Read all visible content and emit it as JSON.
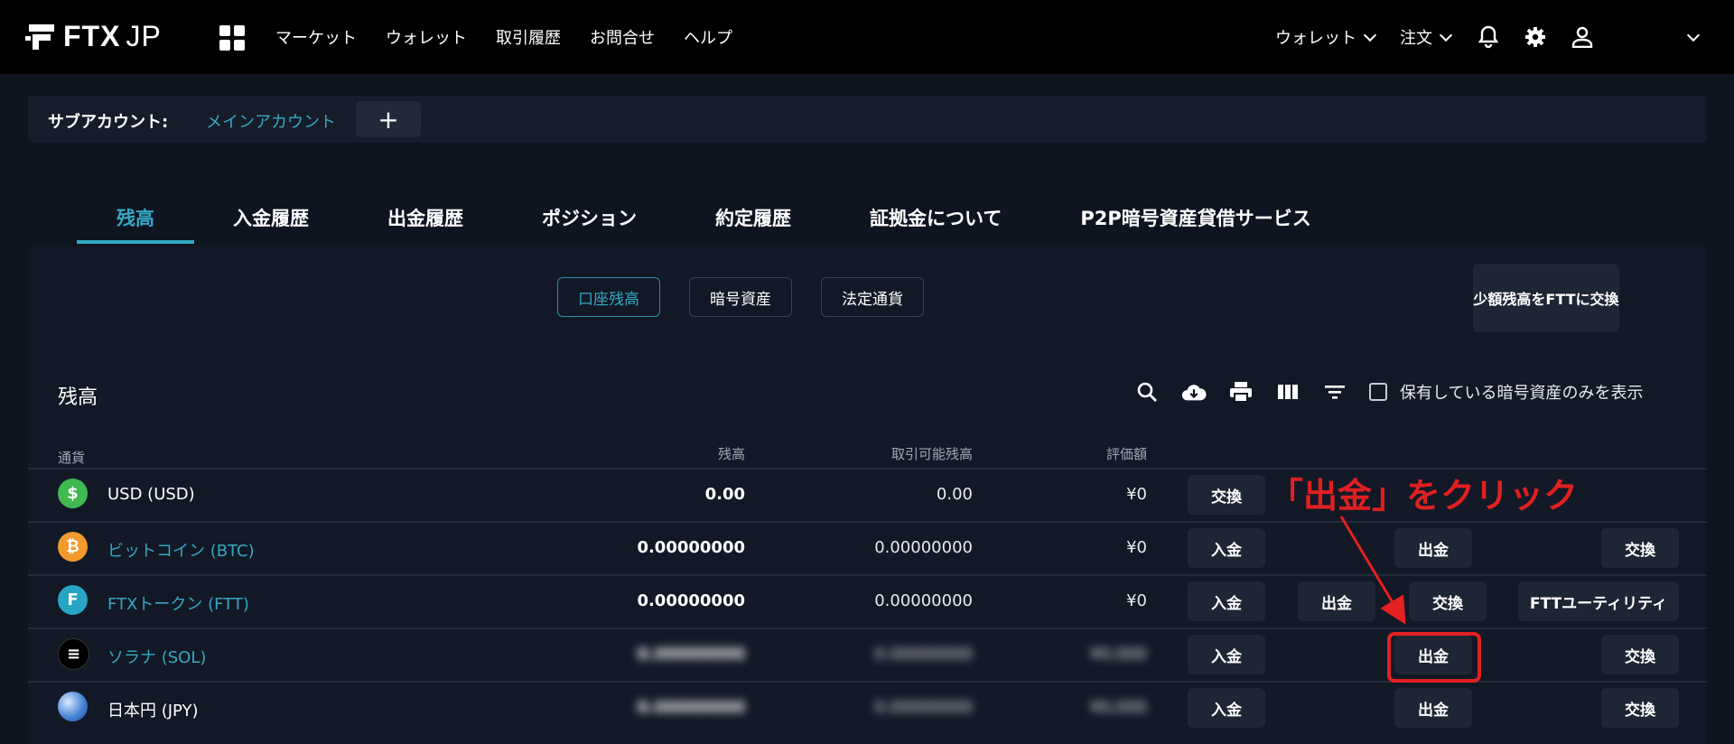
{
  "header": {
    "logo_bold": "FTX",
    "logo_light": "JP",
    "nav": [
      "マーケット",
      "ウォレット",
      "取引履歴",
      "お問合せ",
      "ヘルプ"
    ],
    "right_menu": [
      {
        "label": "ウォレット"
      },
      {
        "label": "注文"
      }
    ],
    "icons": [
      "bell-icon",
      "gear-icon",
      "user-icon",
      "chevron-down-icon"
    ]
  },
  "subaccount": {
    "label": "サブアカウント:",
    "main": "メインアカウント",
    "add": "+"
  },
  "tabs": [
    "残高",
    "入金履歴",
    "出金履歴",
    "ポジション",
    "約定履歴",
    "証拠金について",
    "P2P暗号資産貸借サービス"
  ],
  "filters": [
    "口座残高",
    "暗号資産",
    "法定通貨"
  ],
  "swap_small_label": "少額残高をFTTに交換",
  "section_title": "残高",
  "toolbar": {
    "icons": [
      "search-icon",
      "cloud-download-icon",
      "print-icon",
      "columns-icon",
      "filter-icon"
    ],
    "checkbox_label": "保有している暗号資産のみを表示"
  },
  "table": {
    "headers": {
      "currency": "通貨",
      "balance": "残高",
      "available": "取引可能残高",
      "value": "評価額"
    },
    "rows": [
      {
        "name": "USD (USD)",
        "balance": "0.00",
        "available": "0.00",
        "value": "¥0",
        "actions": [
          "交換"
        ],
        "color": "#3fb950",
        "symbol": "$",
        "link": false
      },
      {
        "name": "ビットコイン (BTC)",
        "balance": "0.00000000",
        "available": "0.00000000",
        "value": "¥0",
        "actions": [
          "入金",
          "出金",
          "交換"
        ],
        "color": "#f39a2e",
        "symbol": "₿",
        "link": true
      },
      {
        "name": "FTXトークン (FTT)",
        "balance": "0.00000000",
        "available": "0.00000000",
        "value": "¥0",
        "actions": [
          "入金",
          "出金",
          "交換",
          "FTTユーティリティ"
        ],
        "color": "#26a6c2",
        "symbol": "F",
        "link": true
      },
      {
        "name": "ソラナ (SOL)",
        "balance": "0.00000000",
        "available": "0.00000000",
        "value": "¥0,000",
        "actions": [
          "入金",
          "出金",
          "交換"
        ],
        "color": "#000000",
        "symbol": "≡",
        "link": true
      },
      {
        "name": "日本円 (JPY)",
        "balance": "0.00000000",
        "available": "0.00000000",
        "value": "¥0,000",
        "actions": [
          "入金",
          "出金",
          "交換"
        ],
        "color": "#3c78d8",
        "symbol": "",
        "link": false
      }
    ]
  },
  "annotation": "「出金」をクリック",
  "colors": {
    "accent": "#35a8c4",
    "annotation": "#e02020",
    "background": "#0f1421"
  }
}
